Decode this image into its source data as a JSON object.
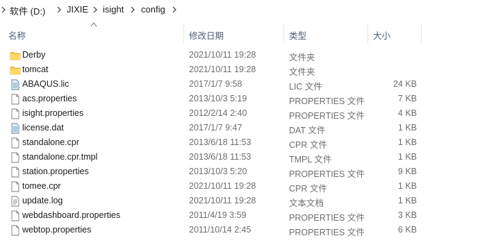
{
  "breadcrumb": {
    "items": [
      "软件 (D:)",
      "JIXIE",
      "isight",
      "config"
    ]
  },
  "columns": {
    "name": "名称",
    "date": "修改日期",
    "type": "类型",
    "size": "大小"
  },
  "files": [
    {
      "name": "Derby",
      "date": "2021/10/11 19:28",
      "type": "文件夹",
      "size": "",
      "icon": "folder-icon"
    },
    {
      "name": "tomcat",
      "date": "2021/10/11 19:28",
      "type": "文件夹",
      "size": "",
      "icon": "folder-icon"
    },
    {
      "name": "ABAQUS.lic",
      "date": "2017/1/7 9:58",
      "type": "LIC 文件",
      "size": "24 KB",
      "icon": "data-file-icon"
    },
    {
      "name": "acs.properties",
      "date": "2013/10/3 5:19",
      "type": "PROPERTIES 文件",
      "size": "7 KB",
      "icon": "file-icon"
    },
    {
      "name": "isight.properties",
      "date": "2012/2/14 2:40",
      "type": "PROPERTIES 文件",
      "size": "4 KB",
      "icon": "file-icon"
    },
    {
      "name": "license.dat",
      "date": "2017/1/7 9:47",
      "type": "DAT 文件",
      "size": "1 KB",
      "icon": "data-file-icon"
    },
    {
      "name": "standalone.cpr",
      "date": "2013/6/18 11:53",
      "type": "CPR 文件",
      "size": "1 KB",
      "icon": "file-icon"
    },
    {
      "name": "standalone.cpr.tmpl",
      "date": "2013/6/18 11:53",
      "type": "TMPL 文件",
      "size": "1 KB",
      "icon": "file-icon"
    },
    {
      "name": "station.properties",
      "date": "2013/10/3 5:20",
      "type": "PROPERTIES 文件",
      "size": "9 KB",
      "icon": "file-icon"
    },
    {
      "name": "tomee.cpr",
      "date": "2021/10/11 19:28",
      "type": "CPR 文件",
      "size": "1 KB",
      "icon": "file-icon"
    },
    {
      "name": "update.log",
      "date": "2021/10/11 19:28",
      "type": "文本文档",
      "size": "1 KB",
      "icon": "text-file-icon"
    },
    {
      "name": "webdashboard.properties",
      "date": "2011/4/19 3:59",
      "type": "PROPERTIES 文件",
      "size": "3 KB",
      "icon": "file-icon"
    },
    {
      "name": "webtop.properties",
      "date": "2011/10/14 2:45",
      "type": "PROPERTIES 文件",
      "size": "6 KB",
      "icon": "file-icon"
    }
  ]
}
